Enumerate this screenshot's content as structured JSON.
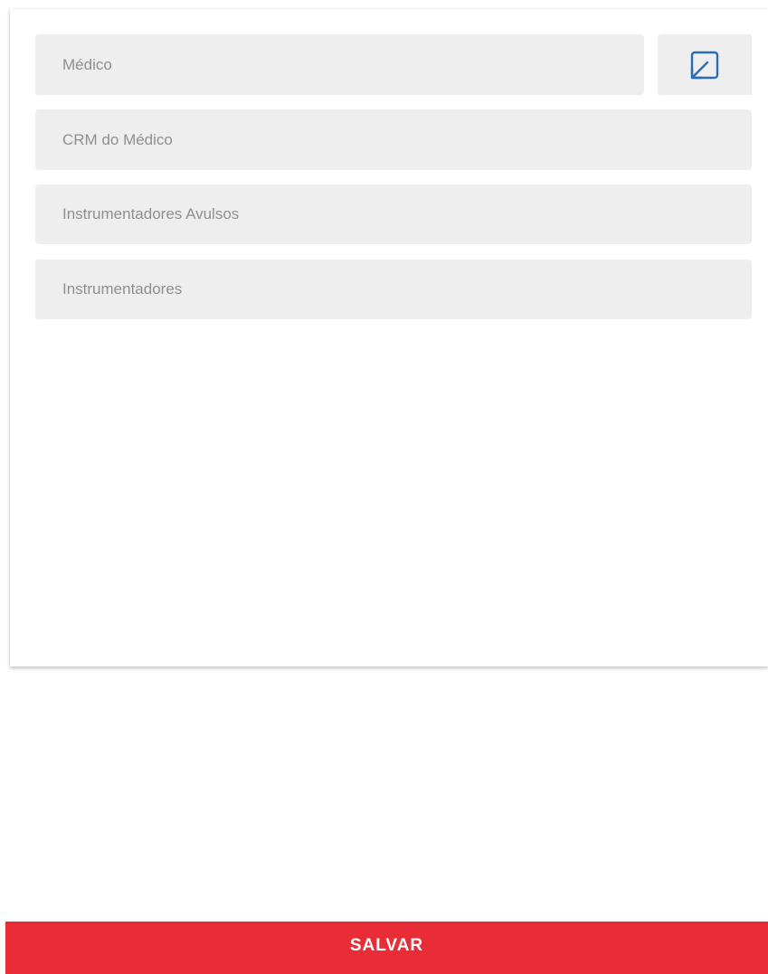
{
  "form": {
    "fields": [
      {
        "placeholder": "Médico"
      },
      {
        "placeholder": "CRM do Médico"
      },
      {
        "placeholder": "Instrumentadores Avulsos"
      },
      {
        "placeholder": "Instrumentadores"
      }
    ],
    "expand_icon": "expand-to-corner-icon"
  },
  "footer": {
    "save_label": "SALVAR"
  },
  "colors": {
    "primary": "#e92d36",
    "field_bg": "#eeeeee",
    "placeholder_text": "#8f8f8f",
    "icon_blue": "#2a6db5"
  }
}
